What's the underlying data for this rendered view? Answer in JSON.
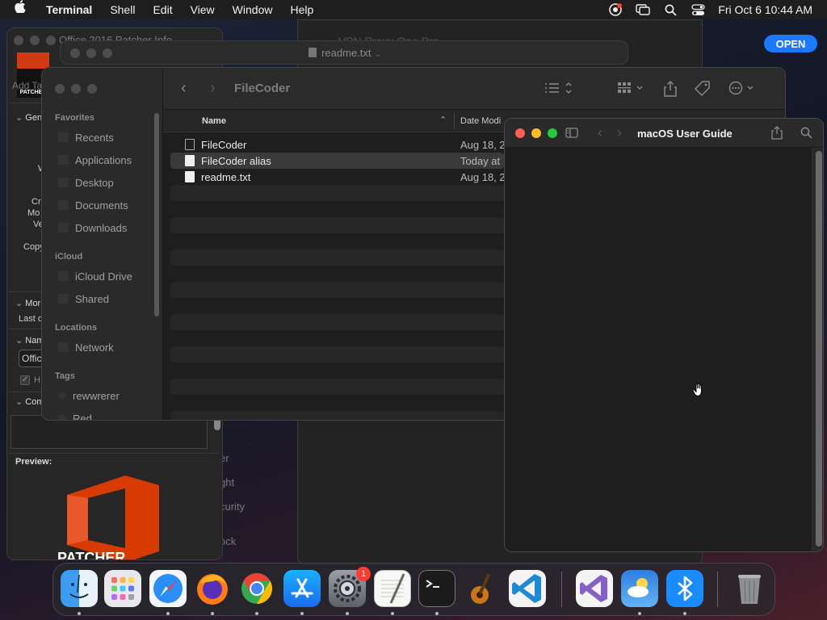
{
  "menubar": {
    "app_name": "Terminal",
    "menus": [
      "Shell",
      "Edit",
      "View",
      "Window",
      "Help"
    ],
    "clock": "Fri Oct 6  10:44 AM"
  },
  "vpn_window": {
    "title": "VPN Proxy One Pro",
    "open_button": "OPEN",
    "sidebar_fragments": [
      "er",
      "ght",
      "curity",
      "ock"
    ]
  },
  "patcher_window": {
    "title": "Office 2016 Patcher Info",
    "logo_text": "PATCHER",
    "add_tags": "Add Ta",
    "sections": {
      "general": "Gen",
      "more_info": "Mor",
      "last_opened": "Last o",
      "name_ext": "Nam",
      "comments": "Com",
      "preview": "Preview:"
    },
    "labels": [
      "W",
      "Cr",
      "Mo",
      "Ve",
      "Copy"
    ],
    "name_field": "Offic",
    "hide_ext": "H",
    "office_logo_text": "PATCHER"
  },
  "readme_window": {
    "title": "readme.txt"
  },
  "finder": {
    "title": "FileCoder",
    "sidebar": {
      "favorites_header": "Favorites",
      "favorites": [
        "Recents",
        "Applications",
        "Desktop",
        "Documents",
        "Downloads"
      ],
      "icloud_header": "iCloud",
      "icloud": [
        "iCloud Drive",
        "Shared"
      ],
      "locations_header": "Locations",
      "locations": [
        "Network"
      ],
      "tags_header": "Tags",
      "tags": [
        "rewwrerer",
        "Red"
      ]
    },
    "columns": {
      "name": "Name",
      "date": "Date Modi"
    },
    "files": [
      {
        "name": "FileCoder",
        "date": "Aug 18, 2"
      },
      {
        "name": "FileCoder alias",
        "date": "Today at"
      },
      {
        "name": "readme.txt",
        "date": "Aug 18, 2"
      }
    ]
  },
  "guide_window": {
    "title": "macOS User Guide"
  },
  "dock": {
    "apps": [
      "Finder",
      "Launchpad",
      "Safari",
      "Firefox",
      "Chrome",
      "App Store",
      "System Settings",
      "TextEdit",
      "Terminal",
      "GarageBand",
      "Visual Studio Code",
      "Visual Studio",
      "Weather",
      "Bluetooth"
    ],
    "settings_badge": "1"
  }
}
